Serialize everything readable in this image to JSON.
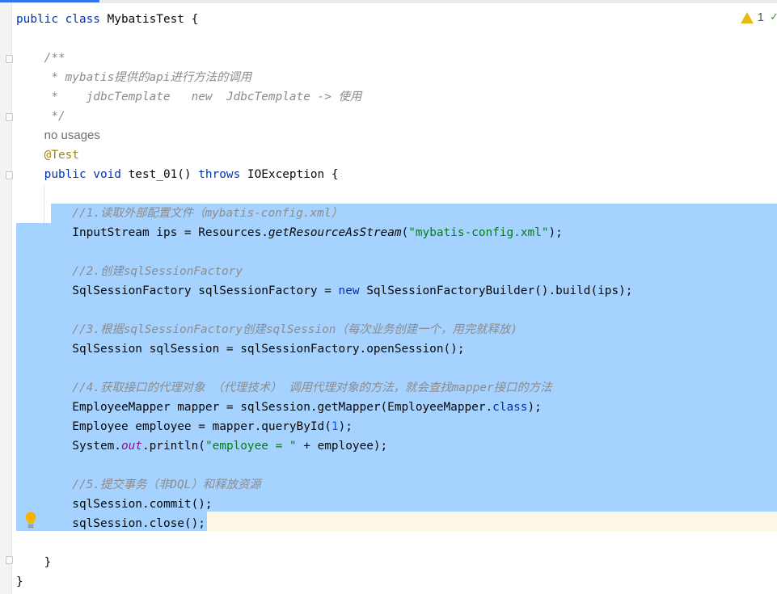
{
  "inspection": {
    "warning_count": "1"
  },
  "code_lines": [
    [
      {
        "t": "public class ",
        "c": "k"
      },
      {
        "t": "MybatisTest {",
        "c": ""
      }
    ],
    [],
    [
      {
        "t": "    /**",
        "c": "c"
      }
    ],
    [
      {
        "t": "     * mybatis提供的api进行方法的调用",
        "c": "c"
      }
    ],
    [
      {
        "t": "     *    jdbcTemplate   new  JdbcTemplate -> 使用",
        "c": "c"
      }
    ],
    [
      {
        "t": "     */",
        "c": "c"
      }
    ],
    [
      {
        "t": "    ",
        "c": ""
      },
      {
        "t": "no usages",
        "c": "u"
      }
    ],
    [
      {
        "t": "    @Test",
        "c": "a"
      }
    ],
    [
      {
        "t": "    public void ",
        "c": "k"
      },
      {
        "t": "test_01() ",
        "c": ""
      },
      {
        "t": "throws ",
        "c": "k"
      },
      {
        "t": "IOException {",
        "c": ""
      }
    ],
    [],
    [
      {
        "t": "        //1.读取外部配置文件（mybatis-config.xml）",
        "c": "c"
      }
    ],
    [
      {
        "t": "        InputStream ips = Resources.",
        "c": ""
      },
      {
        "t": "getResourceAsStream",
        "c": "i"
      },
      {
        "t": "(",
        "c": ""
      },
      {
        "t": "\"mybatis-config.xml\"",
        "c": "s"
      },
      {
        "t": ");",
        "c": ""
      }
    ],
    [],
    [
      {
        "t": "        //2.创建sqlSessionFactory",
        "c": "c"
      }
    ],
    [
      {
        "t": "        SqlSessionFactory sqlSessionFactory = ",
        "c": ""
      },
      {
        "t": "new ",
        "c": "k"
      },
      {
        "t": "SqlSessionFactoryBuilder().build(ips);",
        "c": ""
      }
    ],
    [],
    [
      {
        "t": "        //3.根据sqlSessionFactory创建sqlSession（每次业务创建一个，用完就释放)",
        "c": "c"
      }
    ],
    [
      {
        "t": "        SqlSession sqlSession = sqlSessionFactory.openSession();",
        "c": ""
      }
    ],
    [],
    [
      {
        "t": "        //4.获取接口的代理对象 （代理技术） 调用代理对象的方法，就会查找mapper接口的方法",
        "c": "c"
      }
    ],
    [
      {
        "t": "        EmployeeMapper mapper = sqlSession.getMapper(EmployeeMapper.",
        "c": ""
      },
      {
        "t": "class",
        "c": "k"
      },
      {
        "t": ");",
        "c": ""
      }
    ],
    [
      {
        "t": "        Employee employee = mapper.queryById(",
        "c": ""
      },
      {
        "t": "1",
        "c": "n"
      },
      {
        "t": ");",
        "c": ""
      }
    ],
    [
      {
        "t": "        System.",
        "c": ""
      },
      {
        "t": "out",
        "c": "f"
      },
      {
        "t": ".println(",
        "c": ""
      },
      {
        "t": "\"employee = \"",
        "c": "s"
      },
      {
        "t": " + employee);",
        "c": ""
      }
    ],
    [],
    [
      {
        "t": "        //5.提交事务（非DQL）和释放资源",
        "c": "c"
      }
    ],
    [
      {
        "t": "        sqlSession.commit();",
        "c": ""
      }
    ],
    [
      {
        "t": "        sqlSession.close();",
        "c": ""
      }
    ],
    [],
    [
      {
        "t": "    }",
        "c": ""
      }
    ],
    [
      {
        "t": "}",
        "c": ""
      }
    ]
  ]
}
